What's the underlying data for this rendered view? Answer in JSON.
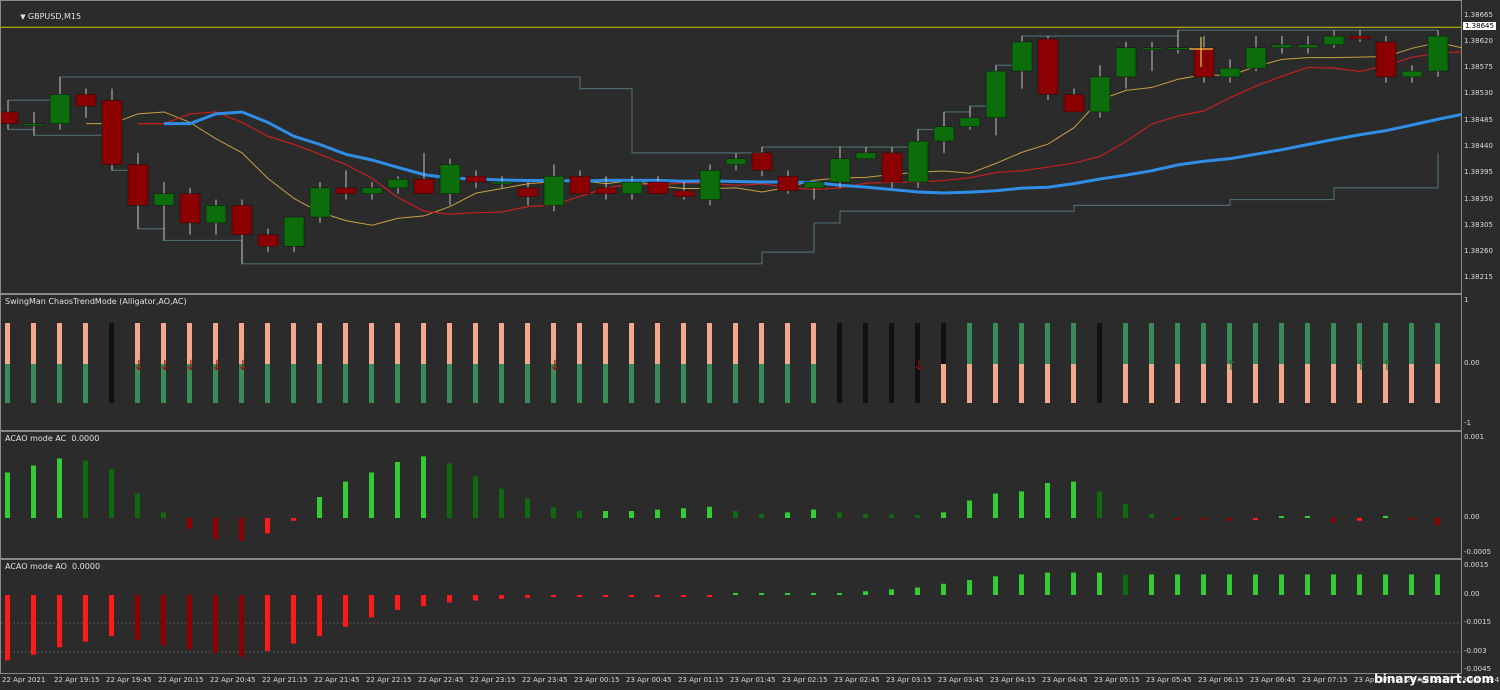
{
  "main": {
    "title": "GBPUSD,M15",
    "ticks": [
      "1.38665",
      "1.38620",
      "1.38575",
      "1.38530",
      "1.38485",
      "1.38440",
      "1.38395",
      "1.38350",
      "1.38305",
      "1.38260",
      "1.38215"
    ],
    "highlight_price": "1.38645",
    "range": [
      1.3819,
      1.3869
    ]
  },
  "swingman": {
    "title": "SwingMan ChaosTrendMode (Alligator,AO,AC)",
    "ticks": [
      "1",
      "0.00",
      "-1"
    ]
  },
  "ac": {
    "title": "ACAO mode AC  0.0000",
    "ticks": [
      "0.001",
      "0.00",
      "-0.0005"
    ]
  },
  "ao": {
    "title": "ACAO mode AO  0.0000",
    "ticks": [
      "0.0015",
      "0.00",
      "-0.0015",
      "-0.003",
      "-0.0045"
    ]
  },
  "time_labels": [
    "22 Apr 2021",
    "22 Apr 19:15",
    "22 Apr 19:45",
    "22 Apr 20:15",
    "22 Apr 20:45",
    "22 Apr 21:15",
    "22 Apr 21:45",
    "22 Apr 22:15",
    "22 Apr 22:45",
    "22 Apr 23:15",
    "22 Apr 23:45",
    "23 Apr 00:15",
    "23 Apr 00:45",
    "23 Apr 01:15",
    "23 Apr 01:45",
    "23 Apr 02:15",
    "23 Apr 02:45",
    "23 Apr 03:15",
    "23 Apr 03:45",
    "23 Apr 04:15",
    "23 Apr 04:45",
    "23 Apr 05:15",
    "23 Apr 05:45",
    "23 Apr 06:15",
    "23 Apr 06:45",
    "23 Apr 07:15",
    "23 Apr 07:45",
    "23 Apr 08:15",
    "23 Apr 08:45"
  ],
  "watermark": "binary-smart.com",
  "colors": {
    "bull": "#0b6e0b",
    "bear": "#8b0000",
    "blue": "#2f8fe8",
    "red": "#c42020",
    "gold": "#c8a040",
    "teal": "#4a6a70",
    "salmon": "#f4a98c",
    "green_bar": "#3b8a5a",
    "ac_bright": "#33cc33",
    "ac_dark": "#106810",
    "ao_red": "#ff1a1a",
    "ao_darkred": "#8b0000"
  },
  "chart_data": {
    "type": "candlestick",
    "symbol": "GBPUSD",
    "timeframe": "M15",
    "candles": [
      [
        1.385,
        1.3852,
        1.3847,
        1.3848
      ],
      [
        1.3848,
        1.385,
        1.3846,
        1.3848
      ],
      [
        1.3848,
        1.3856,
        1.3847,
        1.3853
      ],
      [
        1.3853,
        1.3854,
        1.3849,
        1.3851
      ],
      [
        1.3852,
        1.3854,
        1.384,
        1.3841
      ],
      [
        1.3841,
        1.3843,
        1.383,
        1.3834
      ],
      [
        1.3834,
        1.3838,
        1.3828,
        1.3836
      ],
      [
        1.3836,
        1.3837,
        1.3829,
        1.3831
      ],
      [
        1.3831,
        1.3835,
        1.3829,
        1.3834
      ],
      [
        1.3834,
        1.3835,
        1.3824,
        1.3829
      ],
      [
        1.3829,
        1.383,
        1.3826,
        1.3827
      ],
      [
        1.3827,
        1.3832,
        1.3826,
        1.3832
      ],
      [
        1.3832,
        1.3838,
        1.3831,
        1.3837
      ],
      [
        1.3837,
        1.384,
        1.3835,
        1.3836
      ],
      [
        1.3836,
        1.3838,
        1.3835,
        1.3837
      ],
      [
        1.3837,
        1.3839,
        1.3836,
        1.38385
      ],
      [
        1.38385,
        1.3843,
        1.3836,
        1.3836
      ],
      [
        1.3836,
        1.3842,
        1.3834,
        1.3841
      ],
      [
        1.3839,
        1.384,
        1.3837,
        1.3838
      ],
      [
        1.3838,
        1.3839,
        1.3837,
        1.3838
      ],
      [
        1.3837,
        1.3838,
        1.3834,
        1.38355
      ],
      [
        1.3834,
        1.3841,
        1.3833,
        1.3839
      ],
      [
        1.3839,
        1.384,
        1.3836,
        1.3836
      ],
      [
        1.3837,
        1.3839,
        1.3835,
        1.3836
      ],
      [
        1.3836,
        1.3839,
        1.3835,
        1.3838
      ],
      [
        1.3838,
        1.3839,
        1.3836,
        1.3836
      ],
      [
        1.38365,
        1.3838,
        1.3835,
        1.38355
      ],
      [
        1.3835,
        1.3841,
        1.3834,
        1.384
      ],
      [
        1.3841,
        1.3843,
        1.384,
        1.3842
      ],
      [
        1.3843,
        1.3844,
        1.3839,
        1.384
      ],
      [
        1.3839,
        1.384,
        1.3836,
        1.38365
      ],
      [
        1.3837,
        1.3838,
        1.3835,
        1.3838
      ],
      [
        1.3838,
        1.3844,
        1.3837,
        1.3842
      ],
      [
        1.3842,
        1.3844,
        1.3842,
        1.3843
      ],
      [
        1.3843,
        1.3844,
        1.3837,
        1.3838
      ],
      [
        1.3838,
        1.3847,
        1.3837,
        1.3845
      ],
      [
        1.3845,
        1.385,
        1.3843,
        1.38475
      ],
      [
        1.38475,
        1.3851,
        1.3847,
        1.3849
      ],
      [
        1.3849,
        1.3858,
        1.3846,
        1.3857
      ],
      [
        1.3857,
        1.3863,
        1.3854,
        1.3862
      ],
      [
        1.38625,
        1.3863,
        1.3852,
        1.3853
      ],
      [
        1.3853,
        1.3854,
        1.385,
        1.385
      ],
      [
        1.385,
        1.3858,
        1.3849,
        1.3856
      ],
      [
        1.3856,
        1.3862,
        1.3854,
        1.3861
      ],
      [
        1.3861,
        1.3862,
        1.3857,
        1.3861
      ],
      [
        1.3861,
        1.3864,
        1.386,
        1.3861
      ],
      [
        1.3861,
        1.3863,
        1.3855,
        1.3856
      ],
      [
        1.3856,
        1.3859,
        1.3855,
        1.38575
      ],
      [
        1.38575,
        1.3863,
        1.3857,
        1.3861
      ],
      [
        1.3861,
        1.3863,
        1.386,
        1.38615
      ],
      [
        1.3861,
        1.3863,
        1.386,
        1.38615
      ],
      [
        1.38615,
        1.3864,
        1.3861,
        1.3863
      ],
      [
        1.3863,
        1.3864,
        1.3862,
        1.38625
      ],
      [
        1.3862,
        1.3863,
        1.3855,
        1.3856
      ],
      [
        1.3856,
        1.3858,
        1.3855,
        1.3857
      ],
      [
        1.3857,
        1.3864,
        1.3856,
        1.3863
      ]
    ],
    "swing_modes": [
      "S",
      "S",
      "S",
      "S",
      "B",
      "S",
      "S",
      "S",
      "S",
      "S",
      "S",
      "S",
      "S",
      "S",
      "S",
      "S",
      "S",
      "S",
      "S",
      "S",
      "S",
      "S",
      "S",
      "S",
      "S",
      "S",
      "S",
      "S",
      "S",
      "S",
      "S",
      "S",
      "B",
      "B",
      "B",
      "B",
      "SG",
      "G",
      "G",
      "G",
      "G",
      "G",
      "B",
      "G",
      "G",
      "G",
      "G",
      "G",
      "G",
      "G",
      "G",
      "G",
      "G",
      "G",
      "G",
      "G"
    ],
    "swing_arrows_down": [
      5,
      6,
      7,
      8,
      9,
      21,
      35
    ],
    "swing_arrows_up": [
      47,
      52,
      53
    ],
    "ac_values": [
      0.00065,
      0.00075,
      0.00085,
      0.00082,
      0.0007,
      0.00035,
      8e-05,
      -0.00015,
      -0.0003,
      -0.00033,
      -0.00022,
      -4e-05,
      0.0003,
      0.00052,
      0.00065,
      0.0008,
      0.00088,
      0.00078,
      0.0006,
      0.00042,
      0.00028,
      0.00015,
      0.0001,
      0.0001,
      0.0001,
      0.00012,
      0.00014,
      0.00016,
      0.0001,
      6e-05,
      8e-05,
      0.00012,
      8e-05,
      6e-05,
      5e-05,
      4e-05,
      8e-05,
      0.00025,
      0.00035,
      0.00038,
      0.0005,
      0.00052,
      0.00038,
      0.0002,
      6e-05,
      -2e-05,
      -3e-05,
      -4e-05,
      -2e-05,
      2e-05,
      2e-05,
      -6e-05,
      -4e-05,
      3e-05,
      -2e-05,
      -0.0001,
      -0.00012
    ],
    "ao_values": [
      -0.0035,
      -0.0032,
      -0.0028,
      -0.0025,
      -0.0022,
      -0.0024,
      -0.0027,
      -0.0029,
      -0.0031,
      -0.0033,
      -0.003,
      -0.0026,
      -0.0022,
      -0.0017,
      -0.0012,
      -0.0008,
      -0.0006,
      -0.0004,
      -0.0003,
      -0.0002,
      -0.00015,
      -0.0001,
      -8e-05,
      -5e-05,
      -3e-05,
      -3e-05,
      -2e-05,
      -1e-05,
      2e-05,
      4e-05,
      6e-05,
      8e-05,
      0.0001,
      0.0002,
      0.0003,
      0.0004,
      0.0006,
      0.0008,
      0.001,
      0.0011,
      0.0012,
      0.0012,
      0.0012,
      0.0011,
      0.0011,
      0.0011,
      0.0011,
      0.0011,
      0.0011,
      0.0011,
      0.0011,
      0.0011,
      0.0011,
      0.0011,
      0.0011,
      0.0011
    ]
  }
}
